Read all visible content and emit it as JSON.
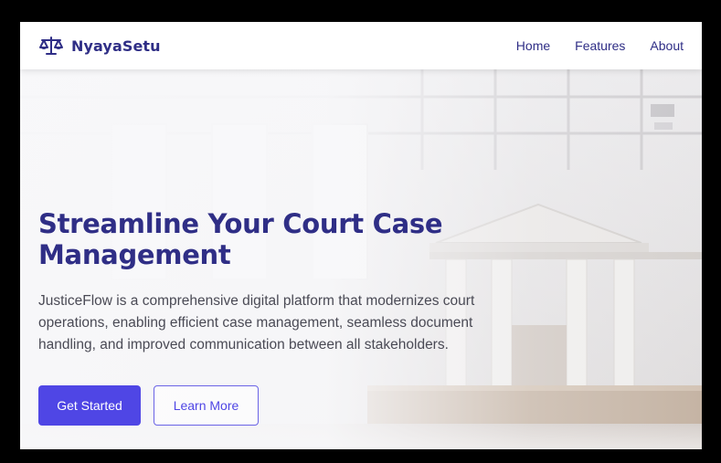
{
  "brand": {
    "name": "NyayaSetu",
    "icon": "scales-icon",
    "color": "#2f2e86"
  },
  "nav": {
    "links": [
      {
        "label": "Home"
      },
      {
        "label": "Features"
      },
      {
        "label": "About"
      }
    ]
  },
  "hero": {
    "title_line1": "Streamline Your Court Case",
    "title_line2": "Management",
    "description_line1": "JusticeFlow is a comprehensive digital platform that modernizes court",
    "description_line2": "operations, enabling efficient case management, seamless document",
    "description_line3": "handling, and improved communication between all stakeholders.",
    "primary_button": "Get Started",
    "secondary_button": "Learn More",
    "accent_color": "#4f46e5"
  }
}
